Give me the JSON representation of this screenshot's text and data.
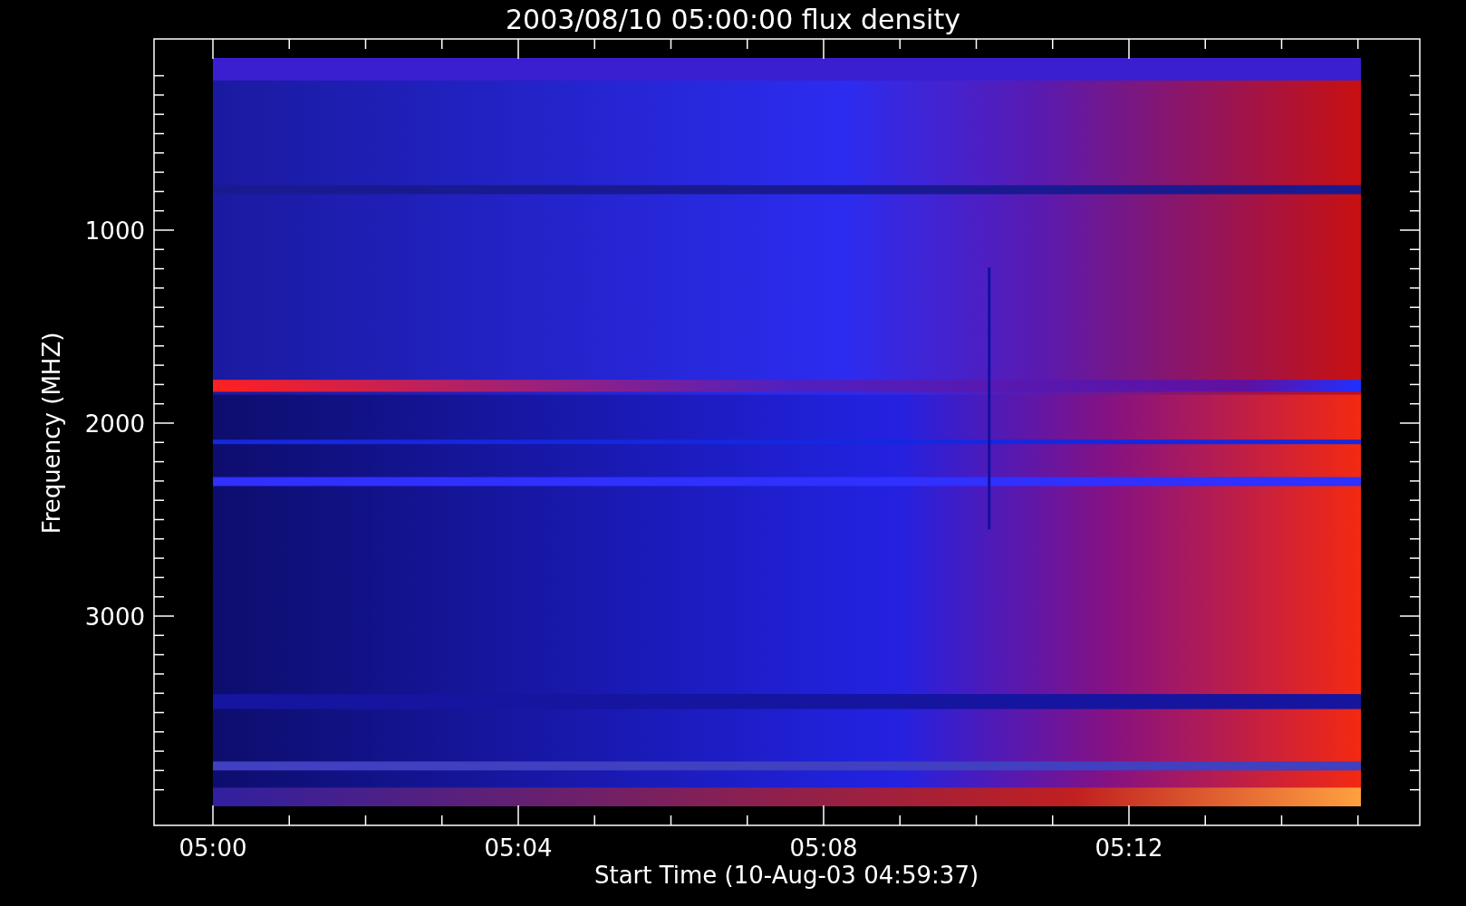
{
  "plot": {
    "title": "2003/08/10 05:00:00 flux density",
    "ylabel": "Frequency (MHZ)",
    "xlabel": "Start Time (10-Aug-03 04:59:37)",
    "yticks": [
      "1000",
      "2000",
      "3000"
    ],
    "xticks": [
      "05:00",
      "05:04",
      "05:08",
      "05:12"
    ]
  }
}
